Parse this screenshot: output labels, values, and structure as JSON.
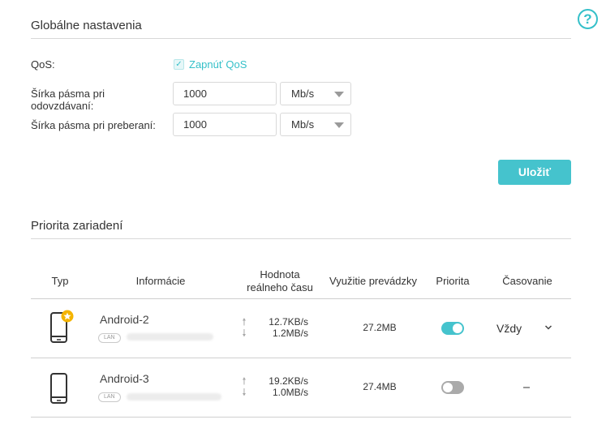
{
  "global": {
    "title": "Globálne nastavenia",
    "qos_label": "QoS:",
    "qos_checkbox_label": "Zapnúť QoS",
    "qos_enabled": true,
    "upload_label_line1": "Šírka pásma pri",
    "upload_label_line2": "odovzdávaní:",
    "upload_value": "1000",
    "upload_unit": "Mb/s",
    "download_label": "Šírka pásma pri preberaní:",
    "download_value": "1000",
    "download_unit": "Mb/s",
    "save_label": "Uložiť"
  },
  "priority": {
    "title": "Priorita zariadení",
    "headers": {
      "type": "Typ",
      "info": "Informácie",
      "realtime_line1": "Hodnota",
      "realtime_line2": "reálneho času",
      "usage": "Využitie prevádzky",
      "priority": "Priorita",
      "schedule": "Časovanie"
    },
    "devices": [
      {
        "name": "Android-2",
        "tag": "LAN",
        "upload_speed": "12.7KB/s",
        "download_speed": "1.2MB/s",
        "usage": "27.2MB",
        "priority_on": true,
        "schedule": "Vždy",
        "starred": true
      },
      {
        "name": "Android-3",
        "tag": "LAN",
        "upload_speed": "19.2KB/s",
        "download_speed": "1.0MB/s",
        "usage": "27.4MB",
        "priority_on": false,
        "schedule": "–",
        "starred": false
      }
    ]
  },
  "colors": {
    "accent": "#45c3cd",
    "toggle_off": "#aaaaaa",
    "star": "#f4b400"
  },
  "icons": {
    "help": "help-circle-icon",
    "check": "checkbox-checked-icon",
    "dropdown": "triangle-down-icon",
    "phone": "smartphone-icon",
    "star": "star-icon",
    "up_arrow": "arrow-up-icon",
    "down_arrow": "arrow-down-icon",
    "chevron": "chevron-down-icon"
  }
}
